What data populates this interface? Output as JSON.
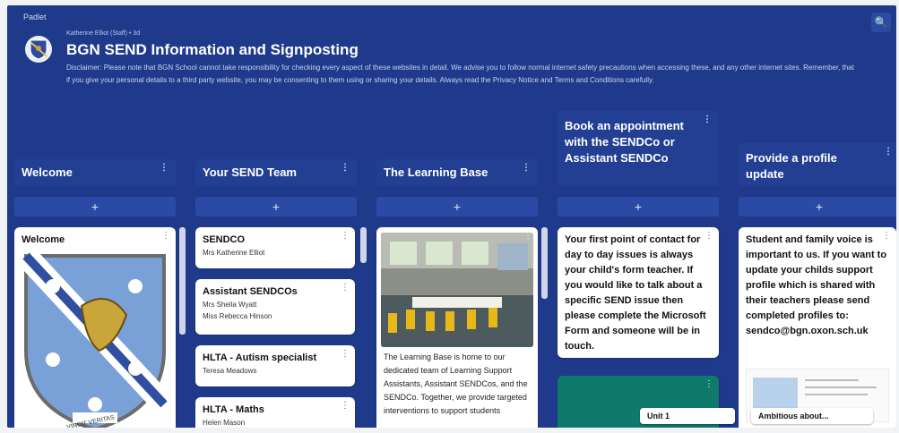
{
  "app": {
    "brand": "Padlet"
  },
  "header": {
    "author": "Katherine Elliot (Staff) • 3d",
    "title": "BGN SEND Information and Signposting",
    "disclaimer": "Disclaimer: Please note that BGN School cannot take responsibility for checking every aspect of these websites in detail. We advise you to follow normal internet safety precautions when accessing these, and any other internet sites. Remember, that if you give your personal details to a third party website, you may be consenting to them using or sharing your details. Always read the Privacy Notice and Terms and Conditions carefully."
  },
  "columns": [
    {
      "title": "Welcome",
      "add": "+"
    },
    {
      "title": "Your SEND Team",
      "add": "+"
    },
    {
      "title": "The Learning Base",
      "add": "+"
    },
    {
      "title": "Book an appointment with the SENDCo or Assistant SENDCo",
      "add": "+"
    },
    {
      "title": "Provide a profile update",
      "add": "+"
    }
  ],
  "cards": {
    "welcome": {
      "title": "Welcome",
      "motto": "VINCIT VERITAS"
    },
    "team": [
      {
        "title": "SENDCO",
        "lines": [
          "Mrs Katherine Elliot"
        ]
      },
      {
        "title": "Assistant SENDCOs",
        "lines": [
          "Mrs Sheila Wyatt",
          "Miss Rebecca Hinson"
        ]
      },
      {
        "title": "HLTA - Autism specialist",
        "lines": [
          "Teresa Meadows"
        ]
      },
      {
        "title": "HLTA - Maths",
        "lines": [
          "Helen Mason"
        ]
      }
    ],
    "learning_base": {
      "text": "The Learning Base is home to our dedicated team of Learning Support Assistants, Assistant SENDCos, and the SENDCo. Together, we provide targeted interventions to support students"
    },
    "book": {
      "text": "Your first point of contact for day to day issues is always your child's form teacher. If you would like to talk about a specific SEND issue then please complete the Microsoft Form and someone will be in touch."
    },
    "profile": {
      "text": "Student and family voice is important to us. If you want to update your childs support profile which is shared with their teachers please send completed profiles to: sendco@bgn.oxon.sch.uk"
    }
  },
  "bottom_chips": {
    "unit": "Unit 1",
    "ambitious": "Ambitious about..."
  },
  "colors": {
    "board": "#1f3a8a",
    "card": "#ffffff",
    "accent_green": "#0f7a6b"
  }
}
